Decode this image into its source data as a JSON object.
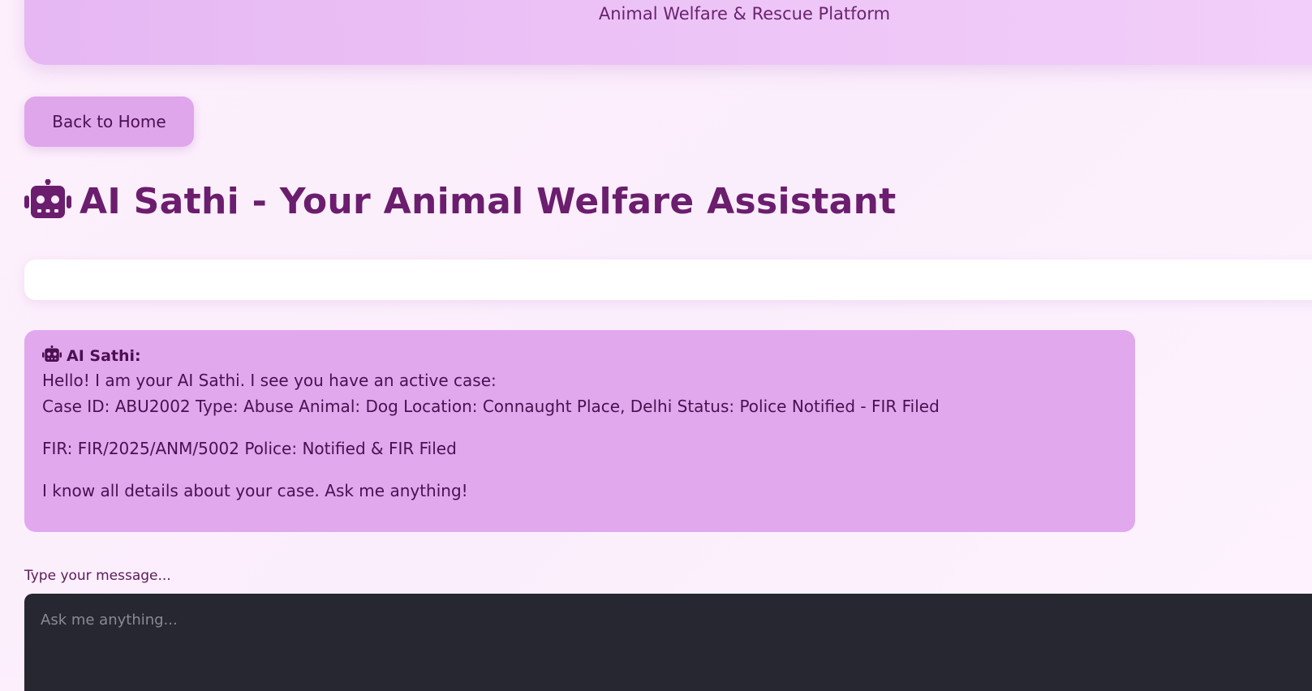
{
  "header": {
    "subtitle": "Animal Welfare & Rescue Platform"
  },
  "nav": {
    "back_label": "Back to Home"
  },
  "page": {
    "title": "AI Sathi - Your Animal Welfare Assistant",
    "title_icon": "robot-icon"
  },
  "chat": {
    "messages": [
      {
        "sender": "AI Sathi:",
        "sender_icon": "robot-icon",
        "lines": [
          "Hello! I am your AI Sathi. I see you have an active case:",
          "Case ID: ABU2002 Type: Abuse Animal: Dog Location: Connaught Place, Delhi Status: Police Notified - FIR Filed",
          "FIR: FIR/2025/ANM/5002 Police: Notified & FIR Filed",
          "I know all details about your case. Ask me anything!"
        ]
      }
    ]
  },
  "input": {
    "label": "Type your message...",
    "placeholder": "Ask me anything...",
    "value": ""
  },
  "colors": {
    "accent": "#6b1d6e",
    "banner": "#e6b7f3",
    "button": "#dfa6ec",
    "message_bg": "#e1a8ee",
    "input_bg": "#262730"
  }
}
